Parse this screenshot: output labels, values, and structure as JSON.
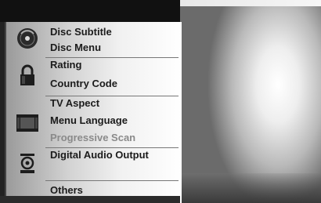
{
  "menu": {
    "groups": [
      {
        "icon": "disc-icon",
        "items": [
          {
            "label": "Disc Subtitle",
            "dim": false
          },
          {
            "label": "Disc Menu",
            "dim": false
          }
        ]
      },
      {
        "icon": "lock-icon",
        "items": [
          {
            "label": "Rating",
            "dim": false
          },
          {
            "label": "Country Code",
            "dim": false
          }
        ]
      },
      {
        "icon": "tv-icon",
        "items": [
          {
            "label": "TV Aspect",
            "dim": false
          },
          {
            "label": "Menu Language",
            "dim": false
          },
          {
            "label": "Progressive Scan",
            "dim": true
          }
        ]
      },
      {
        "icon": "speaker-icon",
        "items": [
          {
            "label": "Digital Audio Output",
            "dim": false
          }
        ]
      },
      {
        "icon": "",
        "items": [
          {
            "label": "Others",
            "dim": false
          }
        ]
      }
    ]
  },
  "colors": {
    "menu_text": "#1b1b1b",
    "dim_text": "#8a8a8a",
    "background_dark": "#111111"
  }
}
